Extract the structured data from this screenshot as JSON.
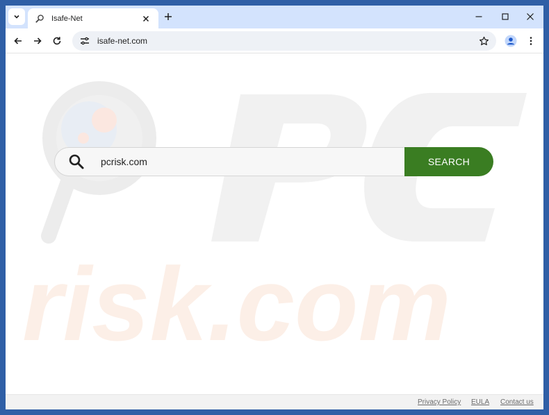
{
  "browser": {
    "tab_title": "Isafe-Net",
    "url": "isafe-net.com"
  },
  "icons": {
    "tab_search": "chevron-down-icon",
    "favicon": "magnifier-icon",
    "tab_close": "close-icon",
    "new_tab": "plus-icon",
    "minimize": "minimize-icon",
    "maximize": "maximize-icon",
    "close": "close-icon",
    "back": "arrow-left-icon",
    "forward": "arrow-right-icon",
    "reload": "reload-icon",
    "site_info": "tune-icon",
    "bookmark": "star-icon",
    "profile": "person-icon",
    "menu": "kebab-menu-icon",
    "search": "search-icon"
  },
  "search": {
    "value": "pcrisk.com",
    "button_label": "SEARCH"
  },
  "footer": {
    "privacy": "Privacy Policy",
    "eula": "EULA",
    "contact": "Contact us"
  },
  "colors": {
    "search_button": "#3a7d22",
    "titlebar": "#d3e3fd",
    "desktop": "#2f5fa6"
  }
}
